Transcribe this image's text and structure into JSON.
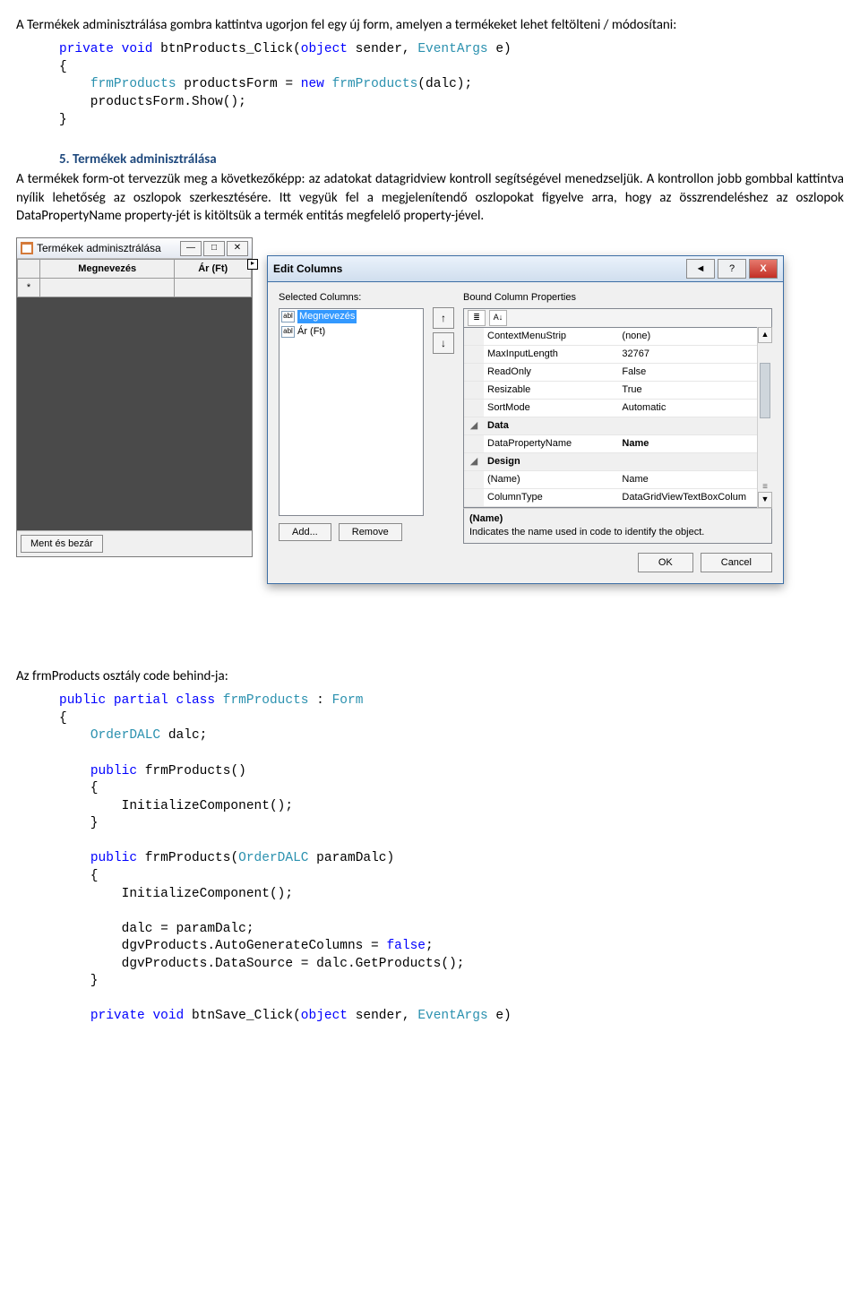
{
  "intro_text": "A Termékek adminisztrálása gombra kattintva ugorjon fel egy új form, amelyen a termékeket lehet feltölteni / módosítani:",
  "code1": {
    "l1a": "private",
    "l1b": "void",
    "l1c": " btnProducts_Click(",
    "l1d": "object",
    "l1e": " sender, ",
    "l1f": "EventArgs",
    "l1g": " e)",
    "l2": "{",
    "l3a": "    ",
    "l3b": "frmProducts",
    "l3c": " productsForm = ",
    "l3d": "new",
    "l3e": " ",
    "l3f": "frmProducts",
    "l3g": "(dalc);",
    "l4": "    productsForm.Show();",
    "l5": "}"
  },
  "section5_title": "5.  Termékek adminisztrálása",
  "section5_p1": "A termékek form-ot tervezzük meg a következőképp: az adatokat datagridview kontroll segítségével menedzseljük. A kontrollon jobb gombbal kattintva nyílik lehetőség az oszlopok szerkesztésére. Itt vegyük fel a megjelenítendő oszlopokat figyelve arra, hogy az összrendeléshez az oszlopok DataPropertyName property-jét is kitöltsük a termék entitás megfelelő property-jével.",
  "frm_products": {
    "title": "Termékek adminisztrálása",
    "col1": "Megnevezés",
    "col2": "Ár (Ft)",
    "row_marker": "*",
    "save_btn": "Ment és bezár",
    "pin": "▸"
  },
  "edit_columns": {
    "title": "Edit Columns",
    "help_btn": "?",
    "close_btn": "X",
    "btn_back": "◄",
    "sel_label": "Selected Columns:",
    "item_icon": "abl",
    "item1": "Megnevezés",
    "item2": "Ár (Ft)",
    "up": "↑",
    "down": "↓",
    "add": "Add...",
    "remove": "Remove",
    "bound_label": "Bound Column Properties",
    "pt_cat": "≣",
    "pt_az": "A↓",
    "props": {
      "r1k": "ContextMenuStrip",
      "r1v": "(none)",
      "r2k": "MaxInputLength",
      "r2v": "32767",
      "r3k": "ReadOnly",
      "r3v": "False",
      "r4k": "Resizable",
      "r4v": "True",
      "r5k": "SortMode",
      "r5v": "Automatic",
      "cat1": "Data",
      "r6k": "DataPropertyName",
      "r6v": "Name",
      "cat2": "Design",
      "r7k": "(Name)",
      "r7v": "Name",
      "r8k": "ColumnType",
      "r8v": "DataGridViewTextBoxColum"
    },
    "help_name": "(Name)",
    "help_desc": "Indicates the name used in code to identify the object.",
    "ok": "OK",
    "cancel": "Cancel",
    "scroll_up": "▲",
    "scroll_down": "▼",
    "scroll_mark": "≡"
  },
  "behind_intro": "Az frmProducts osztály code behind-ja:",
  "code2": {
    "l1a": "public",
    "l1b": "partial",
    "l1c": "class",
    "l1d": "frmProducts",
    "l1e": " : ",
    "l1f": "Form",
    "l2": "{",
    "l3a": "    ",
    "l3b": "OrderDALC",
    "l3c": " dalc;",
    "blank": "",
    "l4a": "    ",
    "l4b": "public",
    "l4c": " frmProducts()",
    "l5": "    {",
    "l6": "        InitializeComponent();",
    "l7": "    }",
    "l8a": "    ",
    "l8b": "public",
    "l8c": " frmProducts(",
    "l8d": "OrderDALC",
    "l8e": " paramDalc)",
    "l9": "    {",
    "l10": "        InitializeComponent();",
    "l11": "        dalc = paramDalc;",
    "l12a": "        dgvProducts.AutoGenerateColumns = ",
    "l12b": "false",
    "l12c": ";",
    "l13": "        dgvProducts.DataSource = dalc.GetProducts();",
    "l14": "    }",
    "l15a": "    ",
    "l15b": "private",
    "l15c": "void",
    "l15d": " btnSave_Click(",
    "l15e": "object",
    "l15f": " sender, ",
    "l15g": "EventArgs",
    "l15h": " e)"
  }
}
